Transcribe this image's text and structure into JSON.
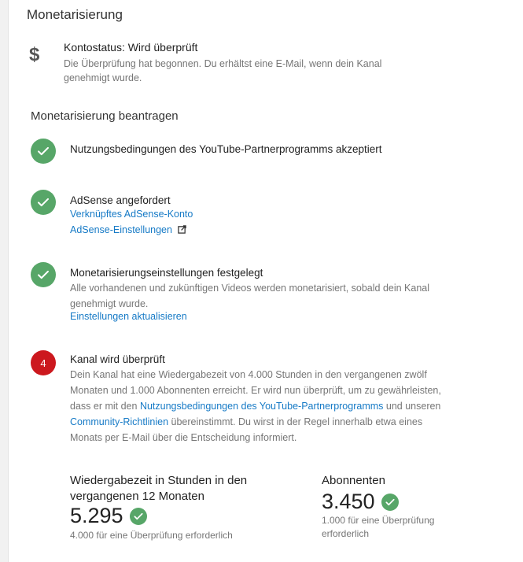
{
  "page": {
    "title": "Monetarisierung"
  },
  "account_status": {
    "icon": "dollar-icon",
    "title": "Kontostatus: Wird überprüft",
    "description": "Die Überprüfung hat begonnen. Du erhältst eine E-Mail, wenn dein Kanal genehmigt wurde."
  },
  "apply": {
    "title": "Monetarisierung beantragen",
    "steps": [
      {
        "status": "done",
        "title": "Nutzungsbedingungen des YouTube-Partnerprogramms akzeptiert"
      },
      {
        "status": "done",
        "title": "AdSense angefordert",
        "link_account": "Verknüpftes AdSense-Konto",
        "link_settings": "AdSense-Einstellungen"
      },
      {
        "status": "done",
        "title": "Monetarisierungseinstellungen festgelegt",
        "description": "Alle vorhandenen und zukünftigen Videos werden monetarisiert, sobald dein Kanal genehmigt wurde.",
        "link_update": "Einstellungen aktualisieren"
      },
      {
        "status": "in-review",
        "number": "4",
        "title": "Kanal wird überprüft",
        "desc_part1": "Dein Kanal hat eine Wiedergabezeit von 4.000 Stunden in den vergangenen zwölf Monaten und 1.000 Abonnenten erreicht. Er wird nun überprüft, um zu gewährleisten, dass er mit den ",
        "link_terms": "Nutzungsbedingungen des YouTube-Partnerprogramms",
        "desc_part2": " und unseren ",
        "link_guidelines": "Community-Richtlinien",
        "desc_part3": " übereinstimmt. Du wirst in der Regel innerhalb etwa eines Monats per E-Mail über die Entscheidung informiert."
      }
    ]
  },
  "metrics": {
    "watch_time": {
      "label": "Wiedergabezeit in Stunden in den vergangenen 12 Monaten",
      "value": "5.295",
      "requirement": "4.000 für eine Überprüfung erforderlich"
    },
    "subscribers": {
      "label": "Abonnenten",
      "value": "3.450",
      "requirement": "1.000 für eine Überprüfung erforderlich"
    }
  },
  "colors": {
    "success": "#57a668",
    "pending": "#cc181e",
    "link": "#167ac6"
  }
}
